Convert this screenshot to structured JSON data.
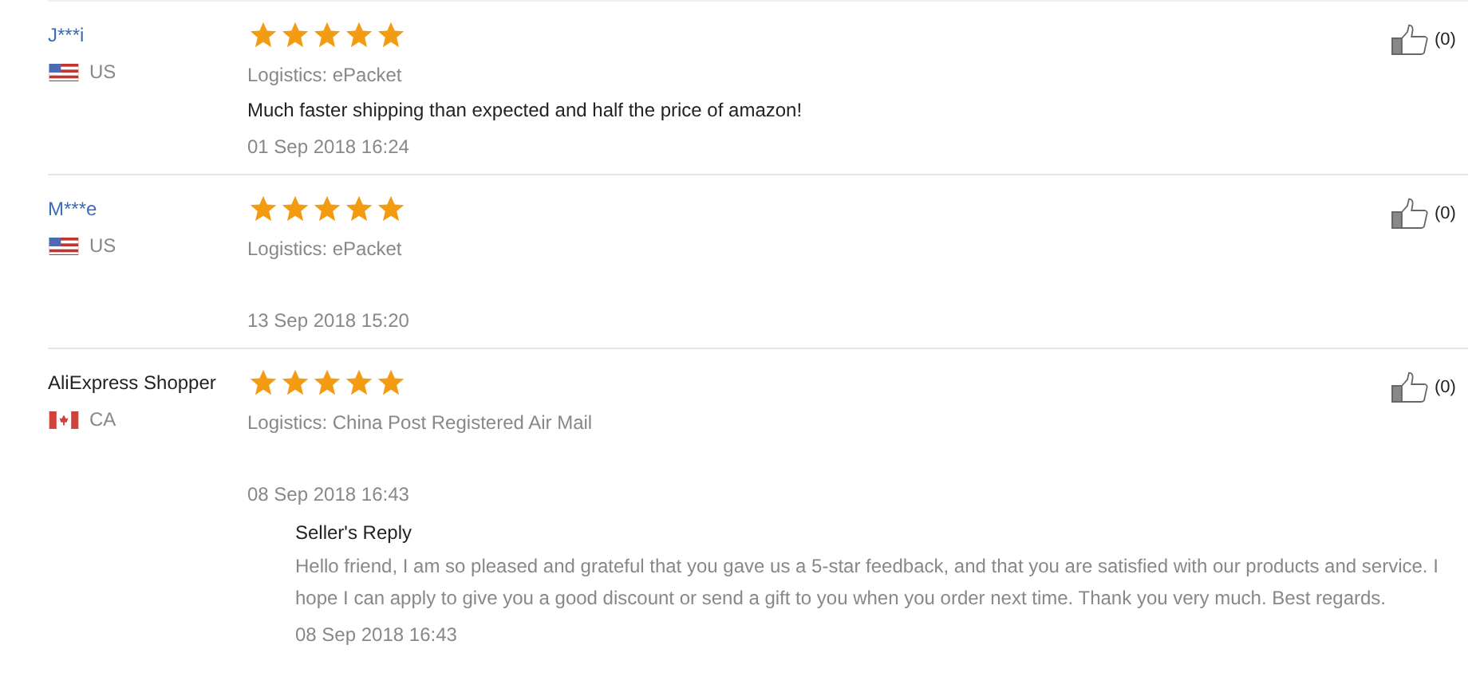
{
  "reviews": [
    {
      "name": "J***i",
      "linked": true,
      "kind": "us",
      "country": "US",
      "stars": 5,
      "logistics": "Logistics: ePacket",
      "comment": "Much faster shipping than expected and half the price of amazon!",
      "date": "01 Sep 2018 16:24",
      "likes": "(0)"
    },
    {
      "name": "M***e",
      "linked": true,
      "kind": "us",
      "country": "US",
      "stars": 5,
      "logistics": "Logistics: ePacket",
      "date": "13 Sep 2018 15:20",
      "likes": "(0)"
    },
    {
      "name": "AliExpress Shopper",
      "linked": false,
      "kind": "ca",
      "country": "CA",
      "stars": 5,
      "logistics": "Logistics: China Post Registered Air Mail",
      "date": "08 Sep 2018 16:43",
      "likes": "(0)",
      "reply": {
        "title": "Seller's Reply",
        "text": "Hello friend, I am so pleased and grateful that you gave us a 5-star feedback, and that you are satisfied with our products and service. I hope I can apply to give you a good discount or send a gift to you when you order next time. Thank you very much. Best regards.",
        "date": "08 Sep 2018 16:43"
      }
    }
  ]
}
